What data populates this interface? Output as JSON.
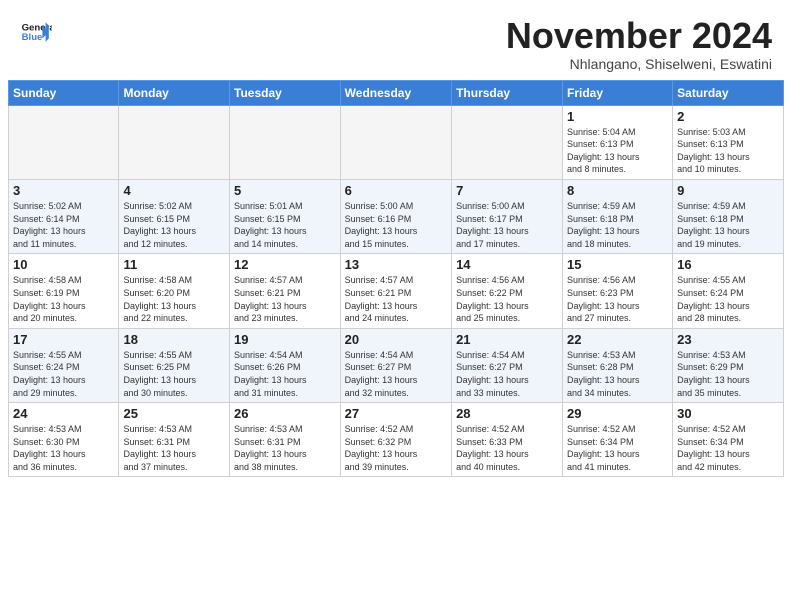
{
  "header": {
    "logo_general": "General",
    "logo_blue": "Blue",
    "month": "November 2024",
    "location": "Nhlangano, Shiselweni, Eswatini"
  },
  "weekdays": [
    "Sunday",
    "Monday",
    "Tuesday",
    "Wednesday",
    "Thursday",
    "Friday",
    "Saturday"
  ],
  "weeks": [
    [
      {
        "day": "",
        "info": ""
      },
      {
        "day": "",
        "info": ""
      },
      {
        "day": "",
        "info": ""
      },
      {
        "day": "",
        "info": ""
      },
      {
        "day": "",
        "info": ""
      },
      {
        "day": "1",
        "info": "Sunrise: 5:04 AM\nSunset: 6:13 PM\nDaylight: 13 hours\nand 8 minutes."
      },
      {
        "day": "2",
        "info": "Sunrise: 5:03 AM\nSunset: 6:13 PM\nDaylight: 13 hours\nand 10 minutes."
      }
    ],
    [
      {
        "day": "3",
        "info": "Sunrise: 5:02 AM\nSunset: 6:14 PM\nDaylight: 13 hours\nand 11 minutes."
      },
      {
        "day": "4",
        "info": "Sunrise: 5:02 AM\nSunset: 6:15 PM\nDaylight: 13 hours\nand 12 minutes."
      },
      {
        "day": "5",
        "info": "Sunrise: 5:01 AM\nSunset: 6:15 PM\nDaylight: 13 hours\nand 14 minutes."
      },
      {
        "day": "6",
        "info": "Sunrise: 5:00 AM\nSunset: 6:16 PM\nDaylight: 13 hours\nand 15 minutes."
      },
      {
        "day": "7",
        "info": "Sunrise: 5:00 AM\nSunset: 6:17 PM\nDaylight: 13 hours\nand 17 minutes."
      },
      {
        "day": "8",
        "info": "Sunrise: 4:59 AM\nSunset: 6:18 PM\nDaylight: 13 hours\nand 18 minutes."
      },
      {
        "day": "9",
        "info": "Sunrise: 4:59 AM\nSunset: 6:18 PM\nDaylight: 13 hours\nand 19 minutes."
      }
    ],
    [
      {
        "day": "10",
        "info": "Sunrise: 4:58 AM\nSunset: 6:19 PM\nDaylight: 13 hours\nand 20 minutes."
      },
      {
        "day": "11",
        "info": "Sunrise: 4:58 AM\nSunset: 6:20 PM\nDaylight: 13 hours\nand 22 minutes."
      },
      {
        "day": "12",
        "info": "Sunrise: 4:57 AM\nSunset: 6:21 PM\nDaylight: 13 hours\nand 23 minutes."
      },
      {
        "day": "13",
        "info": "Sunrise: 4:57 AM\nSunset: 6:21 PM\nDaylight: 13 hours\nand 24 minutes."
      },
      {
        "day": "14",
        "info": "Sunrise: 4:56 AM\nSunset: 6:22 PM\nDaylight: 13 hours\nand 25 minutes."
      },
      {
        "day": "15",
        "info": "Sunrise: 4:56 AM\nSunset: 6:23 PM\nDaylight: 13 hours\nand 27 minutes."
      },
      {
        "day": "16",
        "info": "Sunrise: 4:55 AM\nSunset: 6:24 PM\nDaylight: 13 hours\nand 28 minutes."
      }
    ],
    [
      {
        "day": "17",
        "info": "Sunrise: 4:55 AM\nSunset: 6:24 PM\nDaylight: 13 hours\nand 29 minutes."
      },
      {
        "day": "18",
        "info": "Sunrise: 4:55 AM\nSunset: 6:25 PM\nDaylight: 13 hours\nand 30 minutes."
      },
      {
        "day": "19",
        "info": "Sunrise: 4:54 AM\nSunset: 6:26 PM\nDaylight: 13 hours\nand 31 minutes."
      },
      {
        "day": "20",
        "info": "Sunrise: 4:54 AM\nSunset: 6:27 PM\nDaylight: 13 hours\nand 32 minutes."
      },
      {
        "day": "21",
        "info": "Sunrise: 4:54 AM\nSunset: 6:27 PM\nDaylight: 13 hours\nand 33 minutes."
      },
      {
        "day": "22",
        "info": "Sunrise: 4:53 AM\nSunset: 6:28 PM\nDaylight: 13 hours\nand 34 minutes."
      },
      {
        "day": "23",
        "info": "Sunrise: 4:53 AM\nSunset: 6:29 PM\nDaylight: 13 hours\nand 35 minutes."
      }
    ],
    [
      {
        "day": "24",
        "info": "Sunrise: 4:53 AM\nSunset: 6:30 PM\nDaylight: 13 hours\nand 36 minutes."
      },
      {
        "day": "25",
        "info": "Sunrise: 4:53 AM\nSunset: 6:31 PM\nDaylight: 13 hours\nand 37 minutes."
      },
      {
        "day": "26",
        "info": "Sunrise: 4:53 AM\nSunset: 6:31 PM\nDaylight: 13 hours\nand 38 minutes."
      },
      {
        "day": "27",
        "info": "Sunrise: 4:52 AM\nSunset: 6:32 PM\nDaylight: 13 hours\nand 39 minutes."
      },
      {
        "day": "28",
        "info": "Sunrise: 4:52 AM\nSunset: 6:33 PM\nDaylight: 13 hours\nand 40 minutes."
      },
      {
        "day": "29",
        "info": "Sunrise: 4:52 AM\nSunset: 6:34 PM\nDaylight: 13 hours\nand 41 minutes."
      },
      {
        "day": "30",
        "info": "Sunrise: 4:52 AM\nSunset: 6:34 PM\nDaylight: 13 hours\nand 42 minutes."
      }
    ]
  ]
}
